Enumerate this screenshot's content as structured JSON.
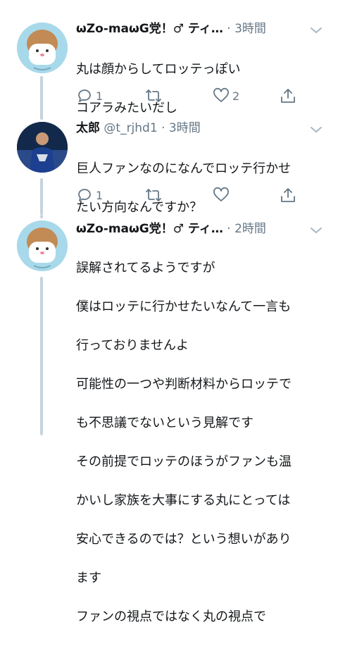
{
  "tweets": [
    {
      "name": "ωZo-maωG党！♂ ティ…",
      "handle": "",
      "sep": "·",
      "time": "3時間",
      "lines": [
        "丸は顔からしてロッテっぽい",
        "コアラみたいだし"
      ],
      "reply_count": "1",
      "retweet_count": "",
      "like_count": "2",
      "avatar": "koala-like-drawn-face-avatar"
    },
    {
      "name": "太郎",
      "handle": "@t_rjhd1",
      "sep": "·",
      "time": "3時間",
      "lines": [
        "巨人ファンなのになんでロッテ行かせ",
        "たい方向なんですか？"
      ],
      "reply_count": "1",
      "retweet_count": "",
      "like_count": "",
      "avatar": "baseball-player-photo-avatar"
    },
    {
      "name": "ωZo-maωG党！♂ ティ…",
      "handle": "",
      "sep": "·",
      "time": "2時間",
      "lines": [
        "誤解されてるようですが",
        "僕はロッテに行かせたいなんて一言も",
        "行っておりませんよ",
        "可能性の一つや判断材料からロッテで",
        "も不思議でないという見解です",
        "その前提でロッテのほうがファンも温",
        "かいし家族を大事にする丸にとっては",
        "安心できるのでは？という想いがあり",
        "ます",
        "ファンの視点ではなく丸の視点で"
      ],
      "avatar": "koala-like-drawn-face-avatar"
    }
  ],
  "colors": {
    "text": "#14171a",
    "muted": "#657786",
    "thread": "#c8d3db",
    "avatar_bg": "#a8d9ea"
  },
  "icons": [
    "reply-icon",
    "retweet-icon",
    "like-icon",
    "share-icon",
    "chevron-down-icon"
  ]
}
